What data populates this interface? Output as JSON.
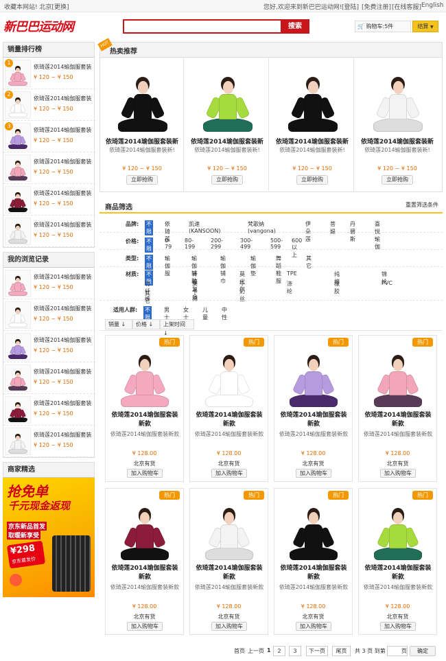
{
  "topbar": {
    "left": "收藏本网站! 北京[更换]",
    "welcome": "您好,欢迎来到新巴巴运动网!",
    "links": [
      "[登陆]",
      "[免费注册]",
      "[在线客服]",
      "English"
    ]
  },
  "header": {
    "logo": "新巴巴运动网",
    "search_button": "搜索",
    "cart": "购物车:5件",
    "checkout": "结算"
  },
  "sidebar": {
    "ranking_title": "销量排行榜",
    "history_title": "我的浏览记录",
    "merchant_title": "商家精选",
    "ranking_items": [
      {
        "rank": "1",
        "title": "依琦莲2014瑜伽服套装",
        "price": "¥ 120 ~ ¥ 150"
      },
      {
        "rank": "2",
        "title": "依琦莲2014瑜伽服套装",
        "price": "¥ 120 ~ ¥ 150"
      },
      {
        "rank": "3",
        "title": "依琦莲2014瑜伽服套装",
        "price": "¥ 120 ~ ¥ 150"
      },
      {
        "rank": "",
        "title": "依琦莲2014瑜伽服套装",
        "price": "¥ 120 ~ ¥ 150"
      },
      {
        "rank": "",
        "title": "依琦莲2014瑜伽服套装",
        "price": "¥ 120 ~ ¥ 150"
      },
      {
        "rank": "",
        "title": "依琦莲2014瑜伽服套装",
        "price": "¥ 120 ~ ¥ 150"
      }
    ],
    "history_items": [
      {
        "title": "依琦莲2014瑜伽服套装",
        "price": "¥ 120 ~ ¥ 150"
      },
      {
        "title": "依琦莲2014瑜伽服套装",
        "price": "¥ 120 ~ ¥ 150"
      },
      {
        "title": "依琦莲2014瑜伽服套装",
        "price": "¥ 120 ~ ¥ 150"
      },
      {
        "title": "依琦莲2014瑜伽服套装",
        "price": "¥ 120 ~ ¥ 150"
      },
      {
        "title": "依琦莲2014瑜伽服套装",
        "price": "¥ 120 ~ ¥ 150"
      },
      {
        "title": "依琦莲2014瑜伽服套装",
        "price": "¥ 120 ~ ¥ 150"
      }
    ],
    "ad": {
      "headline1": "抢免单",
      "headline2": "千元现金返现",
      "line1": "京东新品首发",
      "line2": "取暖新享受",
      "price": "¥298",
      "price_note": "京东首发价"
    }
  },
  "hot": {
    "title": "热卖推荐",
    "ribbon": "HOT",
    "items": [
      {
        "title": "依琦莲2014瑜伽服套装新",
        "sub": "依琦莲2014瑜伽服套装新!",
        "price": "¥ 120 ~ ¥ 150",
        "button": "立即抢购"
      },
      {
        "title": "依琦莲2014瑜伽服套装新",
        "sub": "依琦莲2014瑜伽服套装新!",
        "price": "¥ 120 ~ ¥ 150",
        "button": "立即抢购"
      },
      {
        "title": "依琦莲2014瑜伽服套装新",
        "sub": "依琦莲2014瑜伽服套装新!",
        "price": "¥ 120 ~ ¥ 150",
        "button": "立即抢购"
      },
      {
        "title": "依琦莲2014瑜伽服套装新",
        "sub": "依琦莲2014瑜伽服套装新!",
        "price": "¥ 120 ~ ¥ 150",
        "button": "立即抢购"
      }
    ]
  },
  "filter": {
    "title": "商品筛选",
    "reset": "重置筛选条件",
    "brand_label": "品牌:",
    "brand_options": [
      "不限",
      "依琦莲",
      "凯速(KANSOON)",
      "梵歌纳(vangona)",
      "伊朵莲",
      "菩媞",
      "丹碧斯",
      "喜悦瑜伽"
    ],
    "price_label": "价格:",
    "price_options": [
      "不限",
      "0-79",
      "80-199",
      "200-299",
      "300-499",
      "500-599",
      "600以上"
    ],
    "type_label": "类型:",
    "type_options": [
      "不限",
      "瑜伽服",
      "瑜伽辅助",
      "瑜伽铺巾",
      "瑜伽垫",
      "舞蹈鞋服",
      "其它"
    ],
    "material_label": "材质:",
    "material_options": [
      "不限",
      "纤维复合",
      "莫代尔",
      "TPE",
      "纯棉",
      "锦纶",
      "竹纤维",
      "莱卡棉",
      "牛奶丝",
      "涤纶",
      "橡胶",
      "PVC",
      "其它"
    ],
    "people_label": "适用人群:",
    "people_options": [
      "不限",
      "男士",
      "女士",
      "儿童",
      "中性"
    ]
  },
  "sort": [
    "销量 ↓",
    "价格 ↓",
    "上架时间 ↓"
  ],
  "products": [
    {
      "badge": "热门",
      "title": "依琦莲2014瑜伽服套装新款",
      "sub": "依琦莲2014瑜伽服套装新款",
      "price": "¥ 128.00",
      "stock": "北京有货",
      "button": "加入购物车"
    },
    {
      "badge": "热门",
      "title": "依琦莲2014瑜伽服套装新款",
      "sub": "依琦莲2014瑜伽服套装新款",
      "price": "¥ 128.00",
      "stock": "北京有货",
      "button": "加入购物车"
    },
    {
      "badge": "热门",
      "title": "依琦莲2014瑜伽服套装新款",
      "sub": "依琦莲2014瑜伽服套装新款",
      "price": "¥ 128.00",
      "stock": "北京有货",
      "button": "加入购物车"
    },
    {
      "badge": "热门",
      "title": "依琦莲2014瑜伽服套装新款",
      "sub": "依琦莲2014瑜伽服套装新款",
      "price": "¥ 128.00",
      "stock": "北京有货",
      "button": "加入购物车"
    },
    {
      "badge": "热门",
      "title": "依琦莲2014瑜伽服套装新款",
      "sub": "依琦莲2014瑜伽服套装新款",
      "price": "¥ 128.00",
      "stock": "北京有货",
      "button": "加入购物车"
    },
    {
      "badge": "热门",
      "title": "依琦莲2014瑜伽服套装新款",
      "sub": "依琦莲2014瑜伽服套装新款",
      "price": "¥ 128.00",
      "stock": "北京有货",
      "button": "加入购物车"
    },
    {
      "badge": "热门",
      "title": "依琦莲2014瑜伽服套装新款",
      "sub": "依琦莲2014瑜伽服套装新款",
      "price": "¥ 128.00",
      "stock": "北京有货",
      "button": "加入购物车"
    },
    {
      "badge": "热门",
      "title": "依琦莲2014瑜伽服套装新款",
      "sub": "依琦莲2014瑜伽服套装新款",
      "price": "¥ 128.00",
      "stock": "北京有货",
      "button": "加入购物车"
    }
  ],
  "pagination": {
    "first": "首页",
    "prev": "上一页",
    "pages": [
      "1",
      "2",
      "3"
    ],
    "next": "下一页",
    "last": "尾页",
    "total": "共 3 页 到第",
    "page_unit": "页",
    "confirm": "确定"
  },
  "colors": {
    "brand_red": "#c8161d",
    "price_orange": "#e46a00",
    "badge_orange": "#f39800",
    "filter_selected": "#2d6bc9"
  },
  "outfits": [
    {
      "top": "#f4a9c0",
      "bottom": "#f4a9c0"
    },
    {
      "top": "#ffffff",
      "bottom": "#ffffff"
    },
    {
      "top": "#b79be0",
      "bottom": "#4a2a6b"
    },
    {
      "top": "#f2a6b8",
      "bottom": "#5a3b57"
    },
    {
      "top": "#8b1c3a",
      "bottom": "#111111"
    },
    {
      "top": "#f3f3f3",
      "bottom": "#dddddd"
    },
    {
      "top": "#111111",
      "bottom": "#111111"
    },
    {
      "top": "#a6db3e",
      "bottom": "#1f6e55"
    }
  ]
}
